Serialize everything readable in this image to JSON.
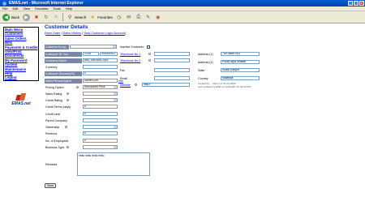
{
  "window": {
    "title": "EMAS.net - Microsoft Internet Explorer"
  },
  "menubar": [
    "File",
    "Edit",
    "View",
    "Favorites",
    "Tools",
    "Help"
  ],
  "toolbar": {
    "back": "Back",
    "search": "Search",
    "favorites": "Favorites"
  },
  "sidebar": {
    "items": [
      "Main Menu",
      "Customers",
      "Sales Orders",
      "Bills",
      "Payments & Credits",
      "View/Print Documents",
      "My Password",
      "System Maintenance",
      "Help",
      "Logout"
    ],
    "logo_text": "EMAS.net"
  },
  "page": {
    "title": "Customer Details",
    "links": [
      "New Order",
      "Sales History",
      "View Customer Login Account"
    ],
    "link_open": "(",
    "link_sep": " | ",
    "link_close": ")"
  },
  "form": {
    "customer_group_label": "CustomerGroup",
    "inactive_label": "Inactive Customer",
    "customer_id_label": "Customer ID / No.",
    "customer_id_value": "CU01",
    "customer_no_value": "000000001",
    "company_name_label": "Company Name",
    "company_name_value": "ABC Sdn Bhd 2003",
    "currency_label": "Currency",
    "customer_discount_label": "Customer Discount(%)",
    "customer_discount_value": "0",
    "sales_agent_label": "Sales Person/Agent",
    "sales_agent_value": "Steven Lim",
    "sales_agent_link": "Info",
    "pricing_option_label": "Pricing Option",
    "pricing_option_value": "Discounted Price",
    "sales_rating_label": "Sales Rating",
    "credit_rating_label": "Credit Rating",
    "credit_terms_label": "Credit Terms (days)",
    "credit_terms_value": "0",
    "credit_limit_label": "Credit Limit",
    "credit_limit_value": "0",
    "parent_company_label": "Parent Company",
    "ownership_label": "Ownership",
    "revenue_label": "Revenue",
    "revenue_value": "0",
    "employees_label": "No. of Employees",
    "employees_value": "0",
    "business_type_label": "Business Type",
    "remarks_label": "Remarks",
    "remarks_value": "hello hello hello hello",
    "phone1_label": "Telephone No.1",
    "phone2_label": "Telephone No.2",
    "fax_label": "Fax",
    "email_label": "Email",
    "website_label": "Website",
    "website_value": "http://",
    "address1_label": "Address (1)",
    "address1_value": "754 Jalan SS2",
    "address2_label": "Address (2)",
    "address2_value": "Pusat Jaya Selatan",
    "state_label": "State",
    "state_value": "Kuala Lumpur",
    "country_label": "Country",
    "country_value": "Malaysia",
    "created_by": "Created by",
    "created_date": "Admin on 01.01.2008",
    "updated": "Last updated by EMP on 1/21/2007 12:34:13 PM",
    "save_label": "Save"
  }
}
